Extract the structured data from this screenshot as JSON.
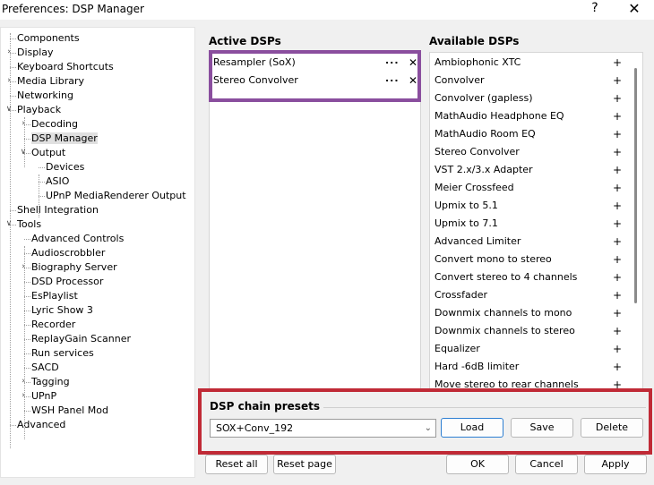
{
  "window": {
    "title": "Preferences: DSP Manager",
    "help_glyph": "?",
    "close_glyph": "✕"
  },
  "tree": [
    {
      "label": "Components",
      "depth": 0,
      "expander": ""
    },
    {
      "label": "Display",
      "depth": 0,
      "expander": ">"
    },
    {
      "label": "Keyboard Shortcuts",
      "depth": 0,
      "expander": ""
    },
    {
      "label": "Media Library",
      "depth": 0,
      "expander": ">"
    },
    {
      "label": "Networking",
      "depth": 0,
      "expander": ""
    },
    {
      "label": "Playback",
      "depth": 0,
      "expander": "v"
    },
    {
      "label": "Decoding",
      "depth": 1,
      "expander": ">"
    },
    {
      "label": "DSP Manager",
      "depth": 1,
      "expander": "",
      "selected": true
    },
    {
      "label": "Output",
      "depth": 1,
      "expander": "v"
    },
    {
      "label": "Devices",
      "depth": 2,
      "expander": ""
    },
    {
      "label": "ASIO",
      "depth": 2,
      "expander": ""
    },
    {
      "label": "UPnP MediaRenderer Output",
      "depth": 2,
      "expander": ""
    },
    {
      "label": "Shell Integration",
      "depth": 0,
      "expander": ""
    },
    {
      "label": "Tools",
      "depth": 0,
      "expander": "v"
    },
    {
      "label": "Advanced Controls",
      "depth": 1,
      "expander": ""
    },
    {
      "label": "Audioscrobbler",
      "depth": 1,
      "expander": ""
    },
    {
      "label": "Biography Server",
      "depth": 1,
      "expander": ">"
    },
    {
      "label": "DSD Processor",
      "depth": 1,
      "expander": ""
    },
    {
      "label": "EsPlaylist",
      "depth": 1,
      "expander": ""
    },
    {
      "label": "Lyric Show 3",
      "depth": 1,
      "expander": ""
    },
    {
      "label": "Recorder",
      "depth": 1,
      "expander": ""
    },
    {
      "label": "ReplayGain Scanner",
      "depth": 1,
      "expander": ""
    },
    {
      "label": "Run services",
      "depth": 1,
      "expander": ""
    },
    {
      "label": "SACD",
      "depth": 1,
      "expander": ""
    },
    {
      "label": "Tagging",
      "depth": 1,
      "expander": ">"
    },
    {
      "label": "UPnP",
      "depth": 1,
      "expander": ">"
    },
    {
      "label": "WSH Panel Mod",
      "depth": 1,
      "expander": ""
    },
    {
      "label": "Advanced",
      "depth": 0,
      "expander": ""
    }
  ],
  "active": {
    "header": "Active DSPs",
    "items": [
      {
        "label": "Resampler (SoX)",
        "more": "...",
        "remove": "✕"
      },
      {
        "label": "Stereo Convolver",
        "more": "...",
        "remove": "✕"
      }
    ]
  },
  "available": {
    "header": "Available DSPs",
    "add_glyph": "+",
    "items": [
      "Ambiophonic XTC",
      "Convolver",
      "Convolver (gapless)",
      "MathAudio Headphone EQ",
      "MathAudio Room EQ",
      "Stereo Convolver",
      "VST 2.x/3.x Adapter",
      "Meier Crossfeed",
      "Upmix to 5.1",
      "Upmix to 7.1",
      "Advanced Limiter",
      "Convert mono to stereo",
      "Convert stereo to 4 channels",
      "Crossfader",
      "Downmix channels to mono",
      "Downmix channels to stereo",
      "Equalizer",
      "Hard -6dB limiter",
      "Move stereo to rear channels"
    ]
  },
  "presets": {
    "title": "DSP chain presets",
    "selected": "SOX+Conv_192",
    "load": "Load",
    "save": "Save",
    "delete": "Delete"
  },
  "footer": {
    "reset_all": "Reset all",
    "reset_page": "Reset page",
    "ok": "OK",
    "cancel": "Cancel",
    "apply": "Apply"
  },
  "colors": {
    "active_highlight": "#8a4e9e",
    "presets_highlight": "#c02a36",
    "primary_border": "#2d7fd2"
  }
}
